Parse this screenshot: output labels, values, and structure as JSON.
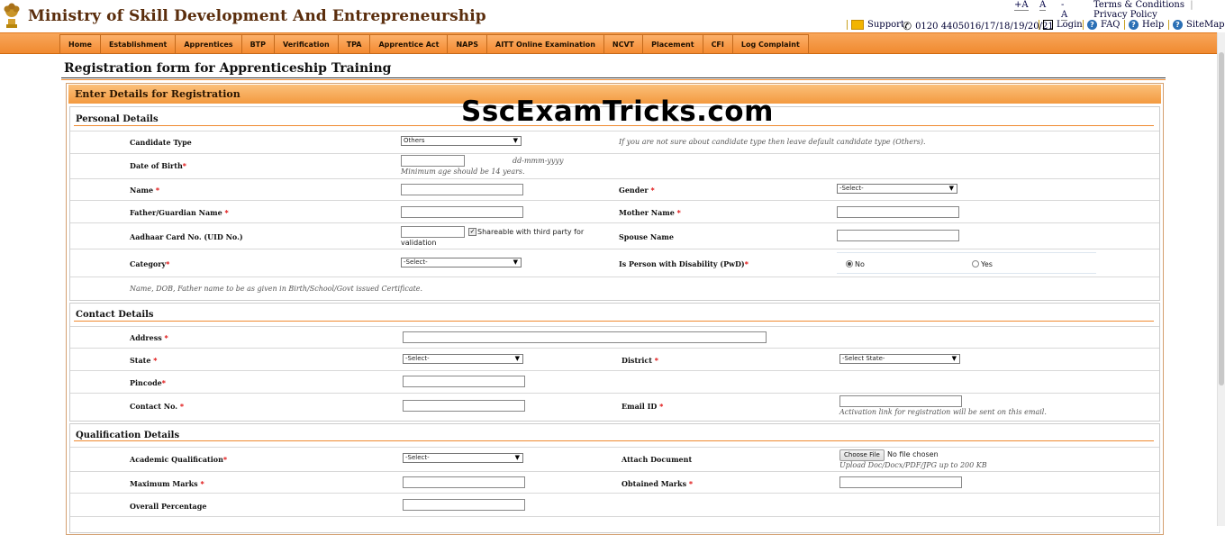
{
  "header": {
    "site_title": "Ministry of Skill Development And Entrepreneurship",
    "font_controls": [
      "+A",
      "A",
      "-A"
    ],
    "terms": "Terms & Conditions",
    "privacy": "Privacy Policy",
    "support": "Support",
    "phone": "0120 4405016/17/18/19/20/21",
    "login": "Login",
    "faq": "FAQ",
    "help": "Help",
    "sitemap": "SiteMap"
  },
  "nav": [
    "Home",
    "Establishment",
    "Apprentices",
    "BTP",
    "Verification",
    "TPA",
    "Apprentice Act",
    "NAPS",
    "AITT Online Examination",
    "NCVT",
    "Placement",
    "CFI",
    "Log Complaint"
  ],
  "page_title": "Registration form for Apprenticeship Training",
  "form_header": "Enter Details for Registration",
  "watermark": "SscExamTricks.com",
  "personal": {
    "title": "Personal Details",
    "candidate_type_label": "Candidate Type",
    "candidate_type_value": "Others",
    "candidate_type_hint": "If you are not sure about candidate type then leave default candidate type (Others).",
    "dob_label": "Date of Birth",
    "dob_format": "dd-mmm-yyyy",
    "dob_hint": "Minimum age should be 14 years.",
    "name_label": "Name",
    "gender_label": "Gender",
    "gender_value": "-Select-",
    "father_label": "Father/Guardian Name",
    "mother_label": "Mother Name",
    "aadhaar_label": "Aadhaar Card No. (UID No.)",
    "share_label_1": "Shareable with third party for",
    "share_label_2": "validation",
    "spouse_label": "Spouse Name",
    "category_label": "Category",
    "category_value": "-Select-",
    "pwd_label": "Is Person with Disability (PwD)",
    "pwd_no": "No",
    "pwd_yes": "Yes",
    "note": "Name, DOB, Father name to be as given in Birth/School/Govt issued Certificate."
  },
  "contact": {
    "title": "Contact Details",
    "address_label": "Address",
    "state_label": "State",
    "state_value": "-Select-",
    "district_label": "District",
    "district_value": "-Select State-",
    "pincode_label": "Pincode",
    "contact_label": "Contact No.",
    "email_label": "Email ID",
    "email_hint": "Activation link for registration will be sent on this email."
  },
  "qualification": {
    "title": "Qualification Details",
    "academic_label": "Academic Qualification",
    "academic_value": "-Select-",
    "attach_label": "Attach Document",
    "choose_file": "Choose File",
    "no_file": "No file chosen",
    "upload_hint": "Upload Doc/Docx/PDF/JPG up to 200 KB",
    "max_marks_label": "Maximum Marks",
    "obtained_label": "Obtained Marks",
    "percentage_label": "Overall Percentage"
  },
  "required_mark": "*"
}
